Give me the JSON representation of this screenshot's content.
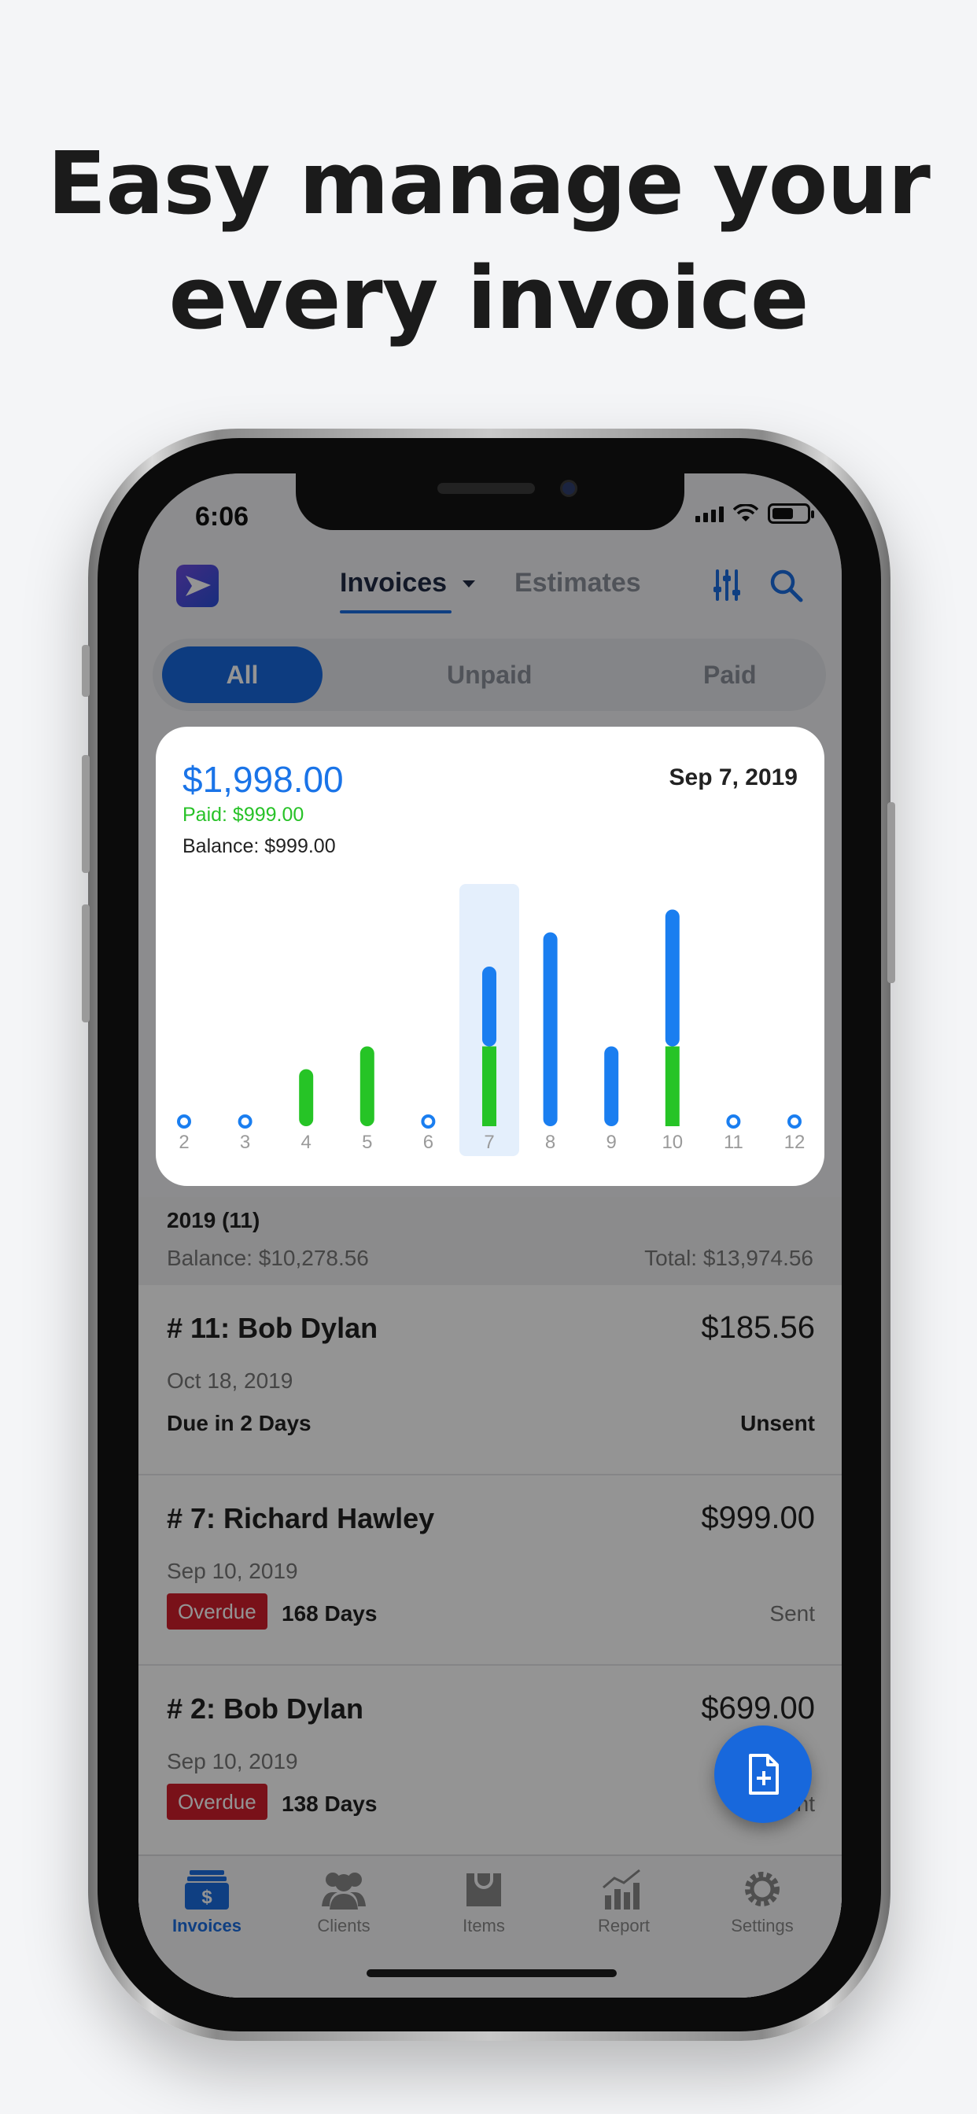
{
  "headline": {
    "line1": "Easy manage your",
    "line2": "every invoice"
  },
  "status_bar": {
    "time": "6:06"
  },
  "nav": {
    "tabs": [
      {
        "label": "Invoices",
        "active": true
      },
      {
        "label": "Estimates",
        "active": false
      }
    ],
    "icons": [
      "app-logo-icon",
      "filter-icon",
      "search-icon"
    ]
  },
  "segment": {
    "options": [
      "All",
      "Unpaid",
      "Paid"
    ],
    "selected": "All"
  },
  "chart_card": {
    "total": "$1,998.00",
    "date": "Sep 7, 2019",
    "paid": "Paid: $999.00",
    "balance": "Balance: $999.00"
  },
  "chart_data": {
    "type": "bar",
    "stacked": true,
    "categories": [
      "2",
      "3",
      "4",
      "5",
      "6",
      "7",
      "8",
      "9",
      "10",
      "11",
      "12"
    ],
    "series": [
      {
        "name": "Paid",
        "color": "#26c426",
        "values": [
          0,
          0,
          250,
          350,
          0,
          350,
          0,
          0,
          350,
          0,
          0
        ]
      },
      {
        "name": "Balance",
        "color": "#1a7ef0",
        "values": [
          0,
          0,
          0,
          0,
          0,
          350,
          850,
          350,
          600,
          0,
          0
        ]
      }
    ],
    "highlighted_category": "7",
    "ylim": [
      0,
      1000
    ]
  },
  "year_group": {
    "title": "2019 (11)",
    "balance": "Balance: $10,278.56",
    "total": "Total: $13,974.56"
  },
  "invoices": [
    {
      "title": "# 11: Bob Dylan",
      "amount": "$185.56",
      "date": "Oct 18, 2019",
      "due": "Due in 2 Days",
      "badge": "",
      "days": "",
      "status": "Unsent"
    },
    {
      "title": "# 7: Richard  Hawley",
      "amount": "$999.00",
      "date": "Sep 10, 2019",
      "due": "",
      "badge": "Overdue",
      "days": "168 Days",
      "status": "Sent"
    },
    {
      "title": "# 2: Bob Dylan",
      "amount": "$699.00",
      "date": "Sep 10, 2019",
      "due": "",
      "badge": "Overdue",
      "days": "138 Days",
      "status": "Sent"
    }
  ],
  "tabbar": [
    {
      "label": "Invoices",
      "icon": "invoices-icon",
      "active": true
    },
    {
      "label": "Clients",
      "icon": "clients-icon",
      "active": false
    },
    {
      "label": "Items",
      "icon": "items-icon",
      "active": false
    },
    {
      "label": "Report",
      "icon": "report-icon",
      "active": false
    },
    {
      "label": "Settings",
      "icon": "settings-icon",
      "active": false
    }
  ],
  "colors": {
    "accent": "#1868dc",
    "paid": "#26c426",
    "overdue": "#d11e2c"
  }
}
